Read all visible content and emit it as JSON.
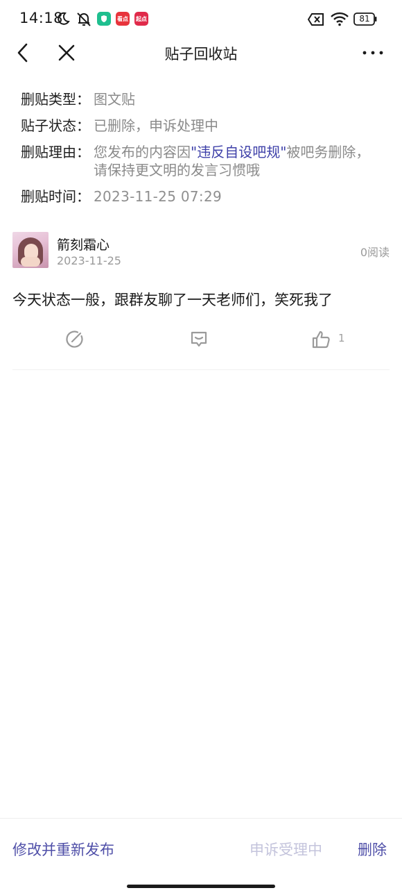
{
  "status_bar": {
    "time": "14:18",
    "apps": [
      "",
      "看点",
      "起点"
    ],
    "battery": "81"
  },
  "nav": {
    "title": "贴子回收站"
  },
  "info": {
    "type_label": "删贴类型：",
    "type_value": "图文贴",
    "status_label": "贴子状态：",
    "status_value": "已删除，申诉处理中",
    "reason_label": "删贴理由：",
    "reason_prefix": "您发布的内容因",
    "reason_highlight": "\"违反自设吧规\"",
    "reason_suffix": "被吧务删除，",
    "reason_line2": "请保持更文明的发言习惯哦",
    "time_label": "删贴时间：",
    "time_value": "2023-11-25 07:29"
  },
  "post": {
    "username": "箭刻霜心",
    "date": "2023-11-25",
    "views": "0阅读",
    "text": "今天状态一般，跟群友聊了一天老师们，笑死我了",
    "like_count": "1"
  },
  "bottom": {
    "republish": "修改并重新发布",
    "appeal": "申诉受理中",
    "delete": "删除"
  },
  "colors": {
    "accent": "#4f4fa8",
    "highlight": "#3d3fa8",
    "muted": "#8a8a8a",
    "disabled": "#c4c4dc"
  }
}
